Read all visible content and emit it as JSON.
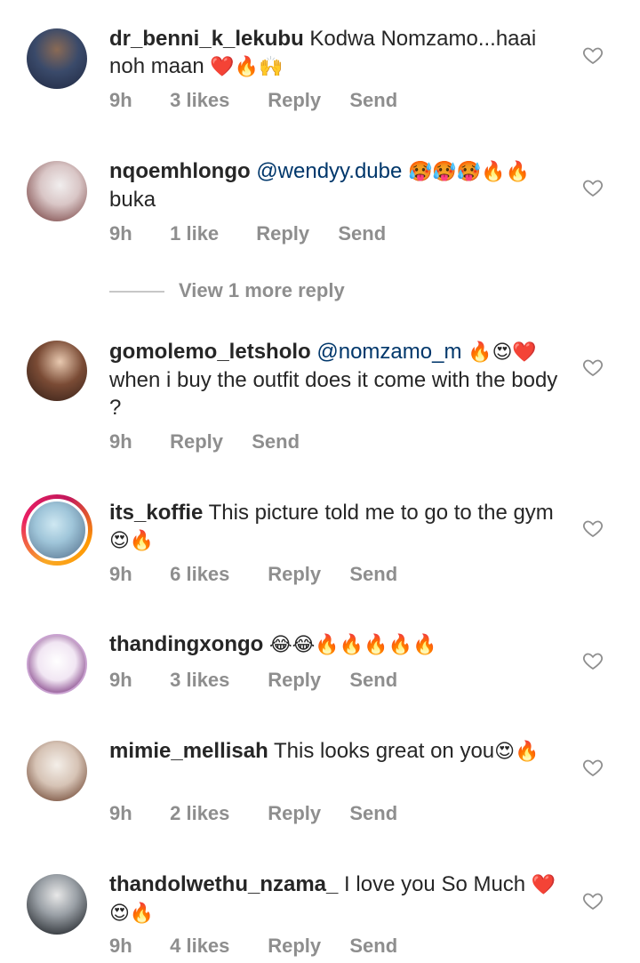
{
  "comments": [
    {
      "username": "dr_benni_k_lekubu",
      "mention": "",
      "text": "Kodwa Nomzamo...haai noh maan",
      "emoji": "❤️🔥🙌",
      "time": "9h",
      "likes": "3 likes",
      "reply": "Reply",
      "send": "Send"
    },
    {
      "username": "nqoemhlongo",
      "mention": "@wendyy.dube",
      "text": "",
      "emoji": "🥵🥵🥵🔥🔥",
      "text_after": "buka",
      "time": "9h",
      "likes": "1 like",
      "reply": "Reply",
      "send": "Send"
    },
    {
      "username": "gomolemo_letsholo",
      "mention": "@nomzamo_m",
      "text": "",
      "emoji": "🔥😍❤️",
      "text_after": "when i buy the outfit does it come with the body ?",
      "time": "9h",
      "likes": "",
      "reply": "Reply",
      "send": "Send"
    },
    {
      "username": "its_koffie",
      "mention": "",
      "text": "This picture told me to go to the gym",
      "emoji": "😍🔥",
      "time": "9h",
      "likes": "6 likes",
      "reply": "Reply",
      "send": "Send"
    },
    {
      "username": "thandingxongo",
      "mention": "",
      "text": "",
      "emoji": "😂😂🔥🔥🔥🔥🔥",
      "time": "9h",
      "likes": "3 likes",
      "reply": "Reply",
      "send": "Send"
    },
    {
      "username": "mimie_mellisah",
      "mention": "",
      "text": "This looks great on you",
      "emoji": "😍🔥",
      "time": "9h",
      "likes": "2 likes",
      "reply": "Reply",
      "send": "Send"
    },
    {
      "username": "thandolwethu_nzama_",
      "mention": "",
      "text": "I love you So Much",
      "emoji": "❤️😍🔥",
      "time": "9h",
      "likes": "4 likes",
      "reply": "Reply",
      "send": "Send"
    }
  ],
  "view_more": "View 1 more reply",
  "icons": {
    "like": "heart-outline-icon"
  },
  "colors": {
    "text": "#262626",
    "secondary": "#8e8e8e",
    "mention": "#00376b"
  }
}
